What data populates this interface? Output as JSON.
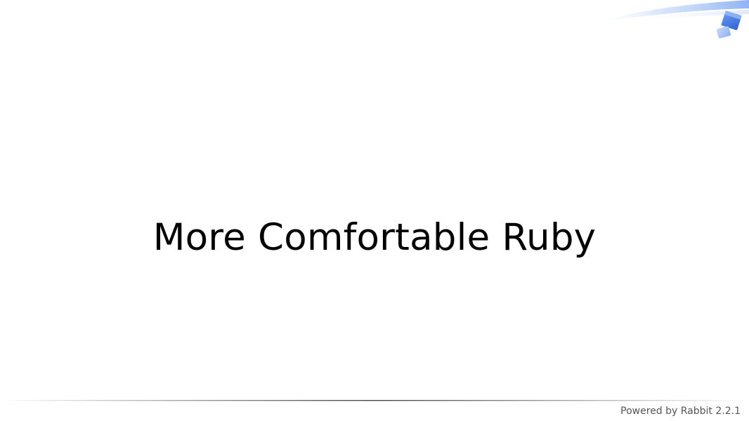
{
  "slide": {
    "title": "More Comfortable Ruby"
  },
  "footer": {
    "text": "Powered by Rabbit 2.2.1"
  },
  "icons": {
    "decoration": "rabbit-swoosh-cube-icon"
  },
  "colors": {
    "background": "#ffffff",
    "title": "#000000",
    "footer_text": "#555555",
    "accent_blue": "#3f78e6"
  }
}
